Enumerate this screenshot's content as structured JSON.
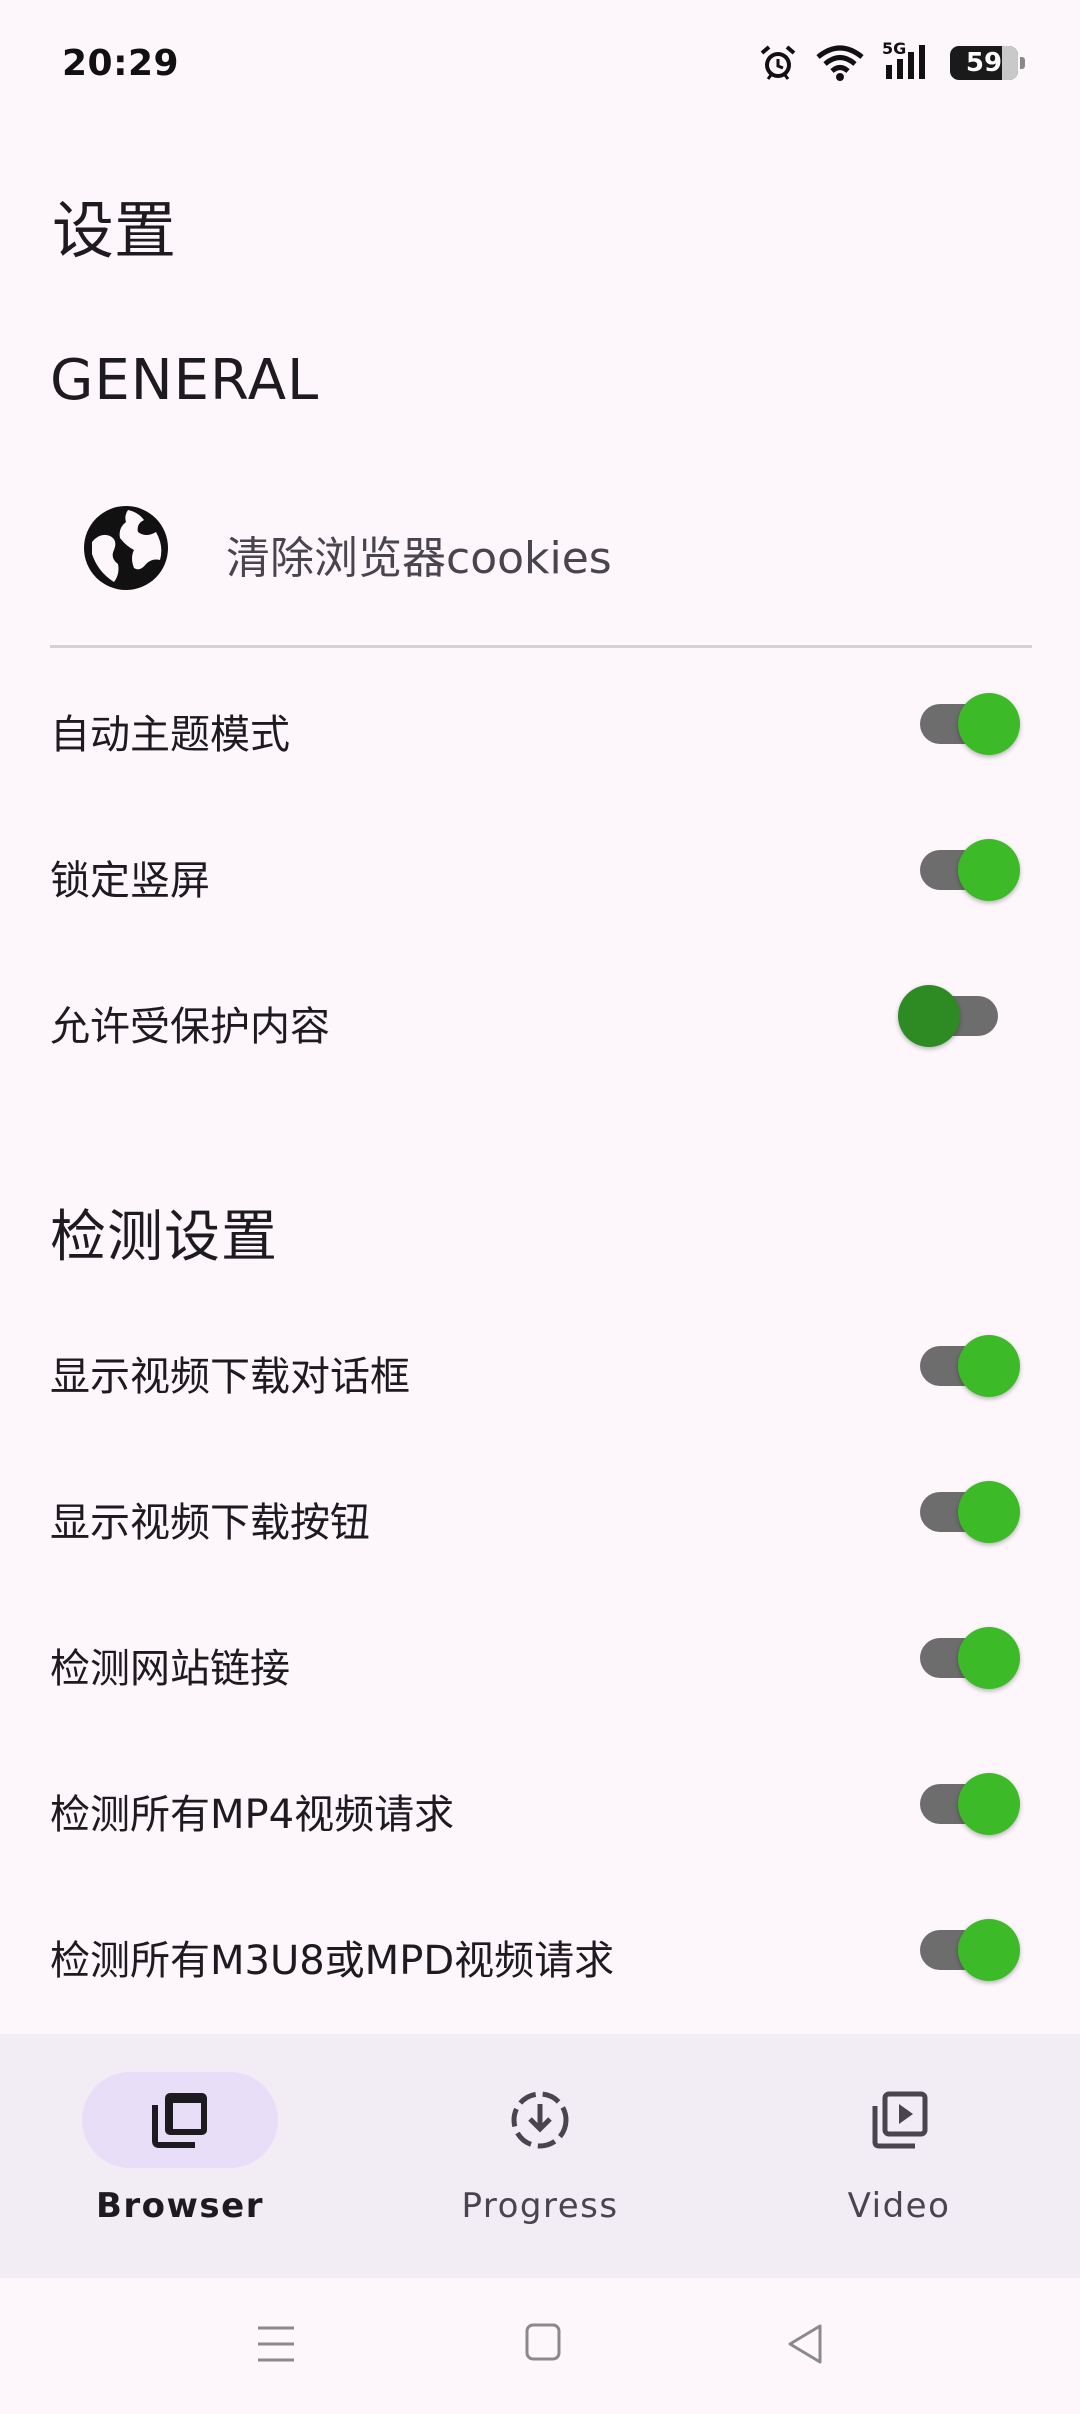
{
  "status_bar": {
    "time": "20:29",
    "network": "5G",
    "battery": "59"
  },
  "page": {
    "title": "设置"
  },
  "general": {
    "header": "GENERAL",
    "clear_cookies_label": "清除浏览器cookies",
    "switches": [
      {
        "label": "自动主题模式",
        "on": true
      },
      {
        "label": "锁定竖屏",
        "on": true
      },
      {
        "label": "允许受保护内容",
        "on": false
      }
    ]
  },
  "detection": {
    "header": "检测设置",
    "switches": [
      {
        "label": "显示视频下载对话框",
        "on": true
      },
      {
        "label": "显示视频下载按钮",
        "on": true
      },
      {
        "label": "检测网站链接",
        "on": true
      },
      {
        "label": "检测所有MP4视频请求",
        "on": true
      },
      {
        "label": "检测所有M3U8或MPD视频请求",
        "on": true
      }
    ]
  },
  "bottom_nav": {
    "items": [
      {
        "label": "Browser",
        "icon": "browser-tabs-icon",
        "selected": true
      },
      {
        "label": "Progress",
        "icon": "download-progress-icon",
        "selected": false
      },
      {
        "label": "Video",
        "icon": "video-library-icon",
        "selected": false
      }
    ]
  },
  "colors": {
    "background": "#fdf7fc",
    "switch_on_thumb": "#3cba27",
    "switch_off_thumb": "#2e8b24",
    "nav_bar": "#f2ecf4",
    "nav_selected_pill": "#e8def8"
  }
}
